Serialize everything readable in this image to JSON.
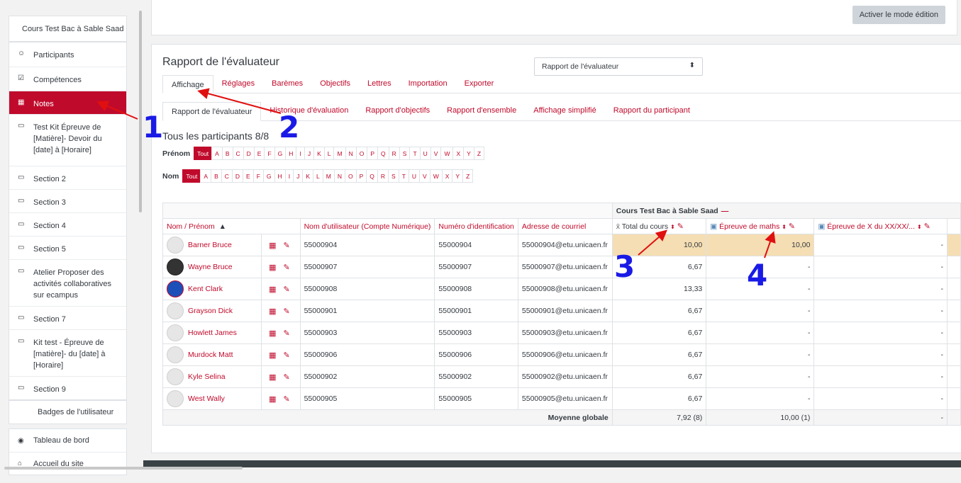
{
  "sidebar": {
    "course": "Cours Test Bac à Sable Saad",
    "items": [
      {
        "label": "Participants",
        "icon": "users-icon"
      },
      {
        "label": "Compétences",
        "icon": "check-square-icon"
      },
      {
        "label": "Notes",
        "icon": "table-icon",
        "active": true
      },
      {
        "label": "Test Kit Épreuve de [Matière]- Devoir du [date] à [Horaire]",
        "icon": "folder-icon"
      },
      {
        "label": "Section 2",
        "icon": "folder-icon"
      },
      {
        "label": "Section 3",
        "icon": "folder-icon"
      },
      {
        "label": "Section 4",
        "icon": "folder-icon"
      },
      {
        "label": "Section 5",
        "icon": "folder-icon"
      },
      {
        "label": "Atelier Proposer des activités collaboratives sur ecampus",
        "icon": "folder-icon"
      },
      {
        "label": "Section 7",
        "icon": "folder-icon"
      },
      {
        "label": "Kit test - Épreuve de [matière]- du [date] à [Horaire]",
        "icon": "folder-icon"
      },
      {
        "label": "Section 9",
        "icon": "folder-icon"
      }
    ],
    "badges": "Badges de l'utilisateur",
    "dashboard": "Tableau de bord",
    "home": "Accueil du site"
  },
  "top": {
    "edit_button": "Activer le mode édition"
  },
  "report": {
    "title": "Rapport de l'évaluateur",
    "select_value": "Rapport de l'évaluateur",
    "tabs": [
      "Affichage",
      "Réglages",
      "Barèmes",
      "Objectifs",
      "Lettres",
      "Importation",
      "Exporter"
    ],
    "subtabs": [
      "Rapport de l'évaluateur",
      "Historique d'évaluation",
      "Rapport d'objectifs",
      "Rapport d'ensemble",
      "Affichage simplifié",
      "Rapport du participant"
    ],
    "participants": "Tous les participants 8/8",
    "prenom_label": "Prénom",
    "nom_label": "Nom",
    "all_label": "Tout",
    "letters": [
      "A",
      "B",
      "C",
      "D",
      "E",
      "F",
      "G",
      "H",
      "I",
      "J",
      "K",
      "L",
      "M",
      "N",
      "O",
      "P",
      "Q",
      "R",
      "S",
      "T",
      "U",
      "V",
      "W",
      "X",
      "Y",
      "Z"
    ]
  },
  "table": {
    "category": "Cours Test Bac à Sable Saad",
    "headers": {
      "name_nom": "Nom",
      "name_sep": " / ",
      "name_prenom": "Prénom",
      "username": "Nom d'utilisateur (Compte Numérique)",
      "idnumber": "Numéro d'identification",
      "email": "Adresse de courriel",
      "total": "Total du cours",
      "maths": "Épreuve de maths",
      "x_exam": "Épreuve de X du XX/XX/..."
    },
    "rows": [
      {
        "name": "Barner Bruce",
        "avatar": "default",
        "username": "55000904",
        "id": "55000904",
        "email": "55000904@etu.unicaen.fr",
        "total": "10,00",
        "maths": "10,00",
        "x": "-"
      },
      {
        "name": "Wayne Bruce",
        "avatar": "dark",
        "username": "55000907",
        "id": "55000907",
        "email": "55000907@etu.unicaen.fr",
        "total": "6,67",
        "maths": "-",
        "x": "-"
      },
      {
        "name": "Kent Clark",
        "avatar": "hero",
        "username": "55000908",
        "id": "55000908",
        "email": "55000908@etu.unicaen.fr",
        "total": "13,33",
        "maths": "-",
        "x": "-"
      },
      {
        "name": "Grayson Dick",
        "avatar": "default",
        "username": "55000901",
        "id": "55000901",
        "email": "55000901@etu.unicaen.fr",
        "total": "6,67",
        "maths": "-",
        "x": "-"
      },
      {
        "name": "Howlett James",
        "avatar": "default",
        "username": "55000903",
        "id": "55000903",
        "email": "55000903@etu.unicaen.fr",
        "total": "6,67",
        "maths": "-",
        "x": "-"
      },
      {
        "name": "Murdock Matt",
        "avatar": "default",
        "username": "55000906",
        "id": "55000906",
        "email": "55000906@etu.unicaen.fr",
        "total": "6,67",
        "maths": "-",
        "x": "-"
      },
      {
        "name": "Kyle Selina",
        "avatar": "default",
        "username": "55000902",
        "id": "55000902",
        "email": "55000902@etu.unicaen.fr",
        "total": "6,67",
        "maths": "-",
        "x": "-"
      },
      {
        "name": "West Wally",
        "avatar": "default",
        "username": "55000905",
        "id": "55000905",
        "email": "55000905@etu.unicaen.fr",
        "total": "6,67",
        "maths": "-",
        "x": "-"
      }
    ],
    "footer": {
      "label": "Moyenne globale",
      "total": "7,92 (8)",
      "maths": "10,00 (1)",
      "x": "-"
    }
  },
  "annotations": [
    "1",
    "2",
    "3",
    "4"
  ],
  "colors": {
    "accent": "#c00a2b",
    "highlight": "#f5deb3",
    "annotation": "#1a1ae6",
    "arrow": "#e01010"
  }
}
